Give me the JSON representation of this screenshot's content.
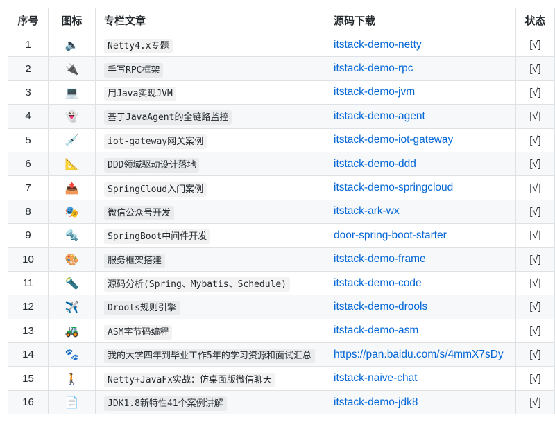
{
  "headers": {
    "no": "序号",
    "icon": "图标",
    "article": "专栏文章",
    "source": "源码下载",
    "status": "状态"
  },
  "rows": [
    {
      "no": "1",
      "icon": "🔈",
      "icon_name": "speaker-icon",
      "article": "Netty4.x专题",
      "source": "itstack-demo-netty",
      "status": "[√]"
    },
    {
      "no": "2",
      "icon": "🔌",
      "icon_name": "plug-icon",
      "article": "手写RPC框架",
      "source": "itstack-demo-rpc",
      "status": "[√]"
    },
    {
      "no": "3",
      "icon": "💻",
      "icon_name": "laptop-icon",
      "article": "用Java实现JVM",
      "source": "itstack-demo-jvm",
      "status": "[√]"
    },
    {
      "no": "4",
      "icon": "👻",
      "icon_name": "ghost-icon",
      "article": "基于JavaAgent的全链路监控",
      "source": "itstack-demo-agent",
      "status": "[√]"
    },
    {
      "no": "5",
      "icon": "💉",
      "icon_name": "syringe-icon",
      "article": "iot-gateway网关案例",
      "source": "itstack-demo-iot-gateway",
      "status": "[√]"
    },
    {
      "no": "6",
      "icon": "📐",
      "icon_name": "ruler-icon",
      "article": "DDD领域驱动设计落地",
      "source": "itstack-demo-ddd",
      "status": "[√]"
    },
    {
      "no": "7",
      "icon": "📤",
      "icon_name": "outbox-icon",
      "article": "SpringCloud入门案例",
      "source": "itstack-demo-springcloud",
      "status": "[√]"
    },
    {
      "no": "8",
      "icon": "🎭",
      "icon_name": "masks-icon",
      "article": "微信公众号开发",
      "source": "itstack-ark-wx",
      "status": "[√]"
    },
    {
      "no": "9",
      "icon": "🔩",
      "icon_name": "bolt-icon",
      "article": "SpringBoot中间件开发",
      "source": "door-spring-boot-starter",
      "status": "[√]"
    },
    {
      "no": "10",
      "icon": "🎨",
      "icon_name": "palette-icon",
      "article": "服务框架搭建",
      "source": "itstack-demo-frame",
      "status": "[√]"
    },
    {
      "no": "11",
      "icon": "🔦",
      "icon_name": "flashlight-icon",
      "article": "源码分析(Spring、Mybatis、Schedule)",
      "source": "itstack-demo-code",
      "status": "[√]"
    },
    {
      "no": "12",
      "icon": "✈️",
      "icon_name": "airplane-icon",
      "article": "Drools规则引擎",
      "source": "itstack-demo-drools",
      "status": "[√]"
    },
    {
      "no": "13",
      "icon": "🚜",
      "icon_name": "tractor-icon",
      "article": "ASM字节码编程",
      "source": "itstack-demo-asm",
      "status": "[√]"
    },
    {
      "no": "14",
      "icon": "🐾",
      "icon_name": "paw-prints-icon",
      "article": "我的大学四年到毕业工作5年的学习资源和面试汇总",
      "source": "https://pan.baidu.com/s/4mmX7sDy",
      "status": "[√]"
    },
    {
      "no": "15",
      "icon": "🚶",
      "icon_name": "walking-icon",
      "article": "Netty+JavaFx实战：仿桌面版微信聊天",
      "source": "itstack-naive-chat",
      "status": "[√]"
    },
    {
      "no": "16",
      "icon": "📄",
      "icon_name": "document-icon",
      "article": "JDK1.8新特性41个案例讲解",
      "source": "itstack-demo-jdk8",
      "status": "[√]"
    }
  ],
  "colors": {
    "link": "#0366d6",
    "border": "#dfe2e5",
    "stripe": "#f6f8fa"
  }
}
